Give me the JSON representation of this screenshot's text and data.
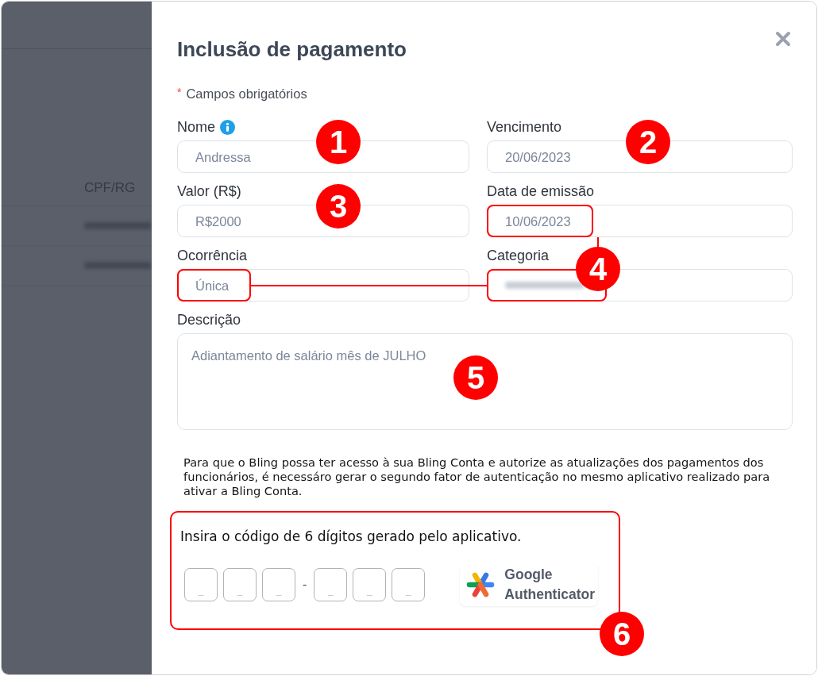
{
  "background": {
    "header": "CPF/RG",
    "rows": [
      {
        "redacted": true
      },
      {
        "redacted": true
      }
    ]
  },
  "dialog": {
    "title": "Inclusão de pagamento",
    "required_note": {
      "marker": "*",
      "text": "Campos obrigatórios"
    },
    "fields": [
      {
        "kind": "input",
        "label": "Nome",
        "info": true,
        "value": "Andressa",
        "redacted": false,
        "highlighted": false,
        "callout": "1"
      },
      {
        "kind": "input",
        "label": "Vencimento",
        "info": false,
        "value": "20/06/2023",
        "redacted": false,
        "highlighted": false,
        "callout": "2"
      },
      {
        "kind": "input",
        "label": "Valor (R$)",
        "info": false,
        "value": "R$2000",
        "redacted": false,
        "highlighted": false,
        "callout": "3"
      },
      {
        "kind": "input",
        "label": "Data de emissão",
        "info": false,
        "value": "10/06/2023",
        "redacted": false,
        "highlighted": true
      },
      {
        "kind": "input",
        "label": "Ocorrência",
        "info": false,
        "value": "Única",
        "redacted": false,
        "highlighted": true
      },
      {
        "kind": "input",
        "label": "Categoria",
        "info": false,
        "redacted": true,
        "highlighted": true,
        "callout": "4"
      },
      {
        "kind": "textarea",
        "label": "Descrição",
        "info": false,
        "value": "Adiantamento de salário mês de JULHO",
        "redacted": false,
        "highlighted": false,
        "callout": "5"
      }
    ],
    "notice": "Para que o Bling possa ter acesso à sua Bling Conta e autorize as atualizações dos pagamentos dos funcionários, é necessáro gerar o segundo fator de autenticação no mesmo aplicativo realizado para ativar a Bling Conta.",
    "verification": {
      "instruction": "Insira o código de 6 dígitos gerado pelo aplicativo.",
      "groups": [
        {
          "digits": [
            {
              "placeholder": "_"
            },
            {
              "placeholder": "_"
            },
            {
              "placeholder": "_"
            }
          ]
        },
        {
          "digits": [
            {
              "placeholder": "_"
            },
            {
              "placeholder": "_"
            },
            {
              "placeholder": "_"
            }
          ]
        }
      ],
      "separator": "-",
      "badge": "Google Authenticator",
      "highlighted": true,
      "callout": "6"
    }
  }
}
